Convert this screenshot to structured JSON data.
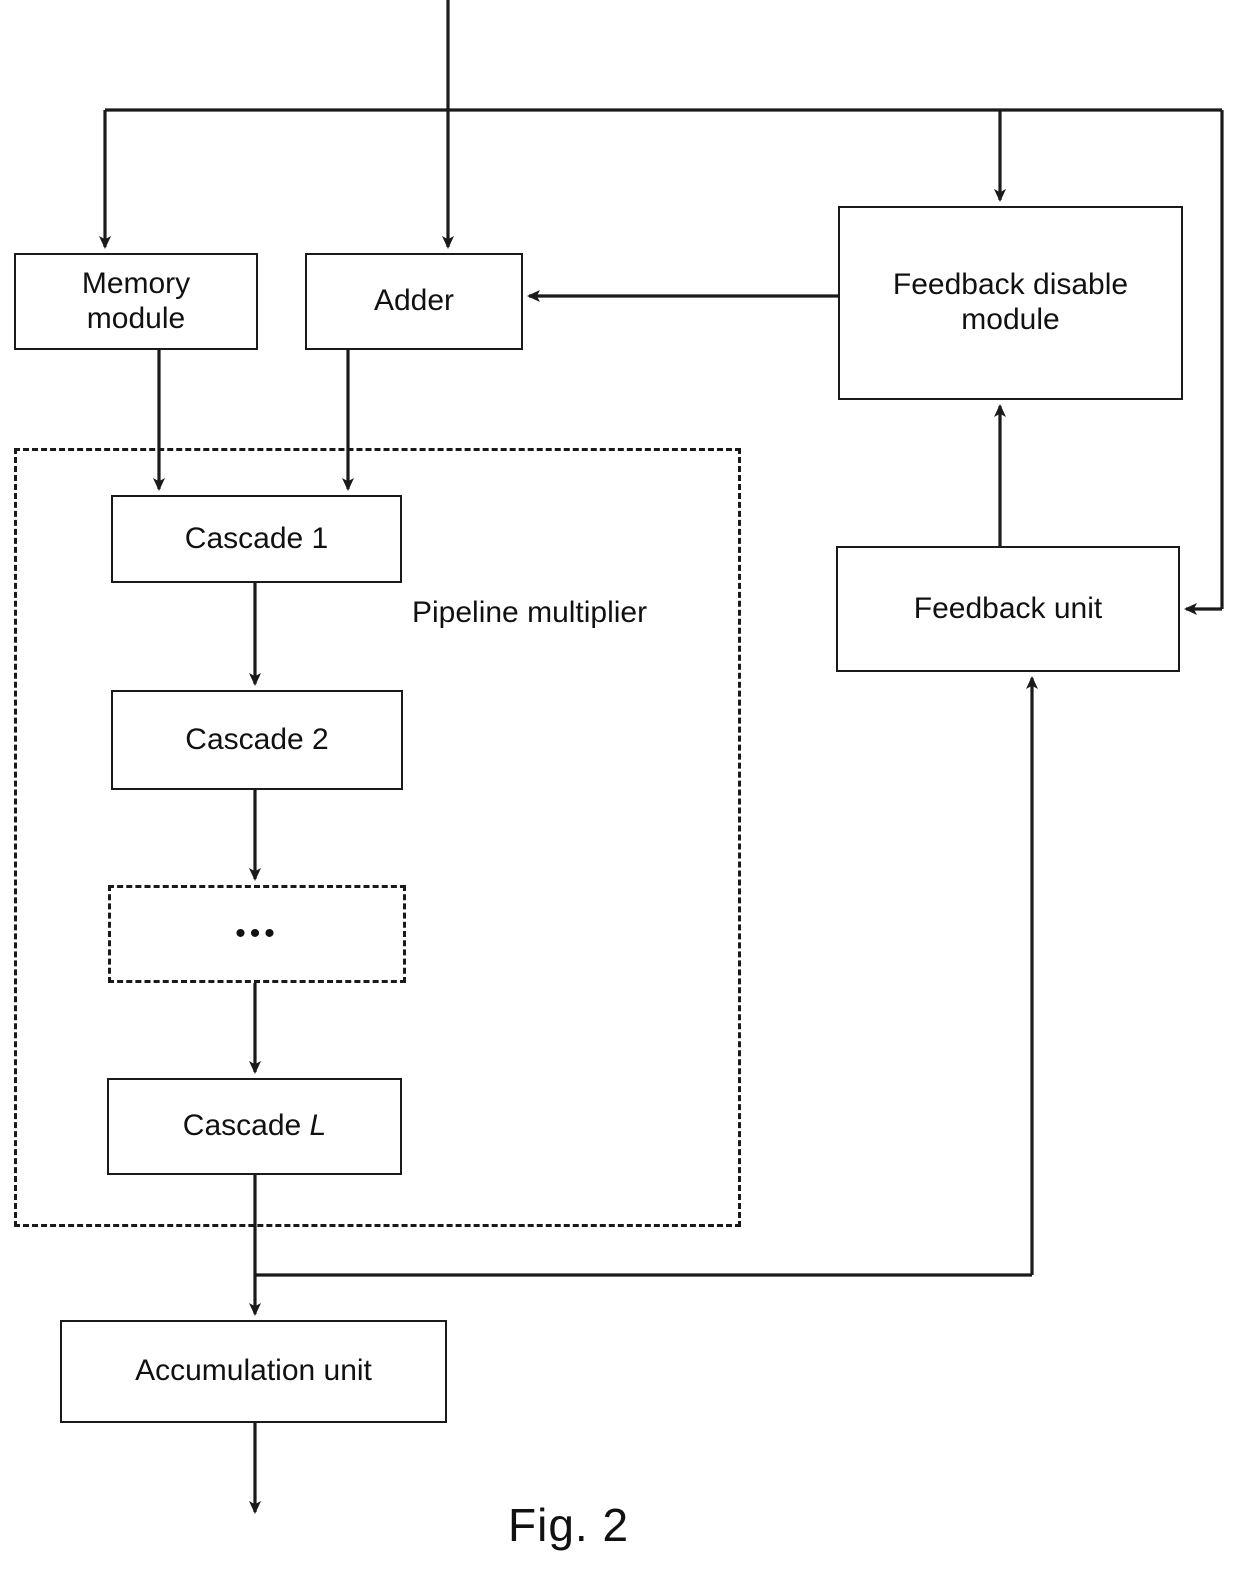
{
  "figure": {
    "caption": "Fig. 2",
    "title_label": "Pipeline multiplier"
  },
  "blocks": {
    "memory_module": {
      "line1": "Memory",
      "line2": "module"
    },
    "adder": {
      "label": "Adder"
    },
    "feedback_disable_module": {
      "line1": "Feedback disable",
      "line2": "module"
    },
    "feedback_unit": {
      "label": "Feedback unit"
    },
    "cascade_1": {
      "label": "Cascade 1"
    },
    "cascade_2": {
      "label": "Cascade 2"
    },
    "cascade_ellipsis": {
      "label": "•••"
    },
    "cascade_l": {
      "prefix": "Cascade ",
      "index": "L"
    },
    "accumulation_unit": {
      "label": "Accumulation unit"
    }
  },
  "colors": {
    "line": "#1a1a1a",
    "background": "#ffffff",
    "text": "#111111"
  },
  "connections": [
    {
      "name": "input-to-adder",
      "from": "input",
      "to": "adder"
    },
    {
      "name": "input-bus-to-memory-module",
      "from": "input-bus",
      "to": "memory_module"
    },
    {
      "name": "input-bus-to-feedback-disable-module",
      "from": "input-bus",
      "to": "feedback_disable_module"
    },
    {
      "name": "input-bus-to-feedback-unit",
      "from": "input-bus",
      "to": "feedback_unit"
    },
    {
      "name": "feedback-disable-module-to-adder",
      "from": "feedback_disable_module",
      "to": "adder"
    },
    {
      "name": "memory-module-to-cascade-1",
      "from": "memory_module",
      "to": "cascade_1"
    },
    {
      "name": "adder-to-cascade-1",
      "from": "adder",
      "to": "cascade_1"
    },
    {
      "name": "cascade-1-to-cascade-2",
      "from": "cascade_1",
      "to": "cascade_2"
    },
    {
      "name": "cascade-2-to-ellipsis",
      "from": "cascade_2",
      "to": "cascade_ellipsis"
    },
    {
      "name": "ellipsis-to-cascade-l",
      "from": "cascade_ellipsis",
      "to": "cascade_l"
    },
    {
      "name": "cascade-l-to-accumulation-unit",
      "from": "cascade_l",
      "to": "accumulation_unit"
    },
    {
      "name": "cascade-l-to-feedback-unit",
      "from": "cascade_l",
      "to": "feedback_unit"
    },
    {
      "name": "feedback-unit-to-feedback-disable-module",
      "from": "feedback_unit",
      "to": "feedback_disable_module"
    },
    {
      "name": "accumulation-unit-output",
      "from": "accumulation_unit",
      "to": "output"
    }
  ]
}
